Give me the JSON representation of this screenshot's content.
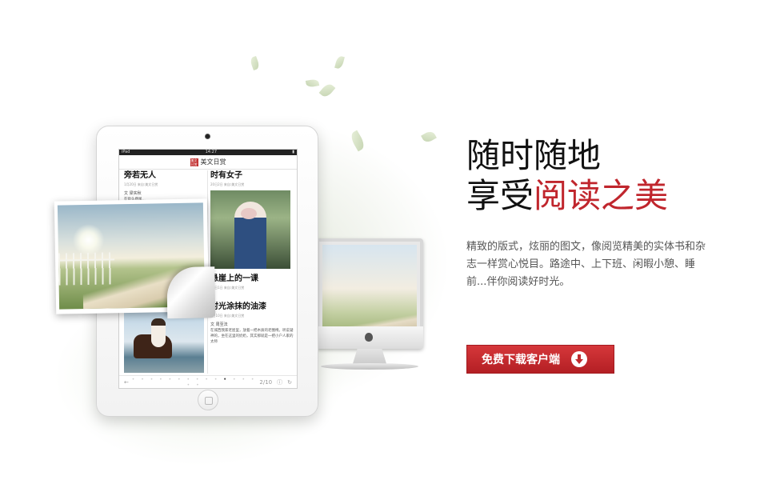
{
  "headline": {
    "line1": "随时随地",
    "line2_prefix": "享受",
    "line2_highlight": "阅读之美"
  },
  "description": "精致的版式，炫丽的图文，像阅览精美的实体书和杂志一样赏心悦目。路途中、上下班、闲暇小憩、睡前...伴你阅读好时光。",
  "download_button": {
    "label": "免费下载客户端",
    "icon": "download-arrow-icon"
  },
  "ipad_app": {
    "status_left": "iPad",
    "status_time": "14:27",
    "app_icon_text": "美文日赏",
    "app_title": "美文日赏",
    "articles": [
      {
        "title": "旁若无人",
        "meta": "1月20日  来自:美文日赏",
        "author": "文  梁实秋",
        "body": "在街头巷尾..."
      },
      {
        "title": "时有女子",
        "meta": "20日2日  来自:美文日赏"
      },
      {
        "title": "悬崖上的一课",
        "meta": "20日1日  来自:美文日赏"
      },
      {
        "title": "时光涂抹的油漆",
        "meta": "2日10日  来自:美文日赏",
        "author": "文  周至法",
        "body": "在城西我家老屋里，放着一把木质的老圈椅。听说凝神的，坐在这里的奶奶，其实那就是一把小户人家的太师"
      }
    ],
    "pager_back": "←",
    "pager_page": "2/10",
    "pager_info": "ⓘ",
    "pager_refresh": "↻"
  },
  "colors": {
    "accent_red": "#c0262d",
    "button_red": "#c12a2e"
  }
}
